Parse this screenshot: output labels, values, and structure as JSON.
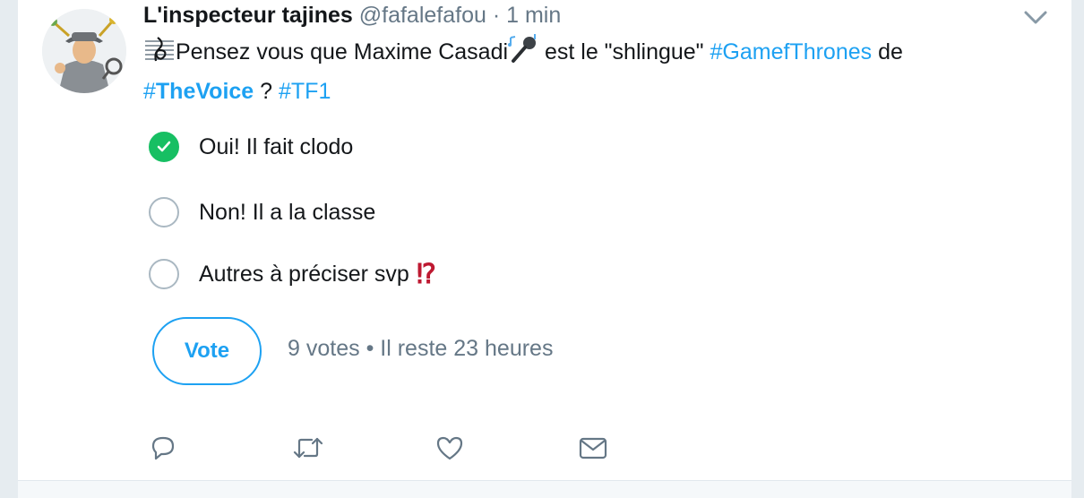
{
  "tweet": {
    "author_name": "L'inspecteur tajines",
    "handle": "@fafalefafou",
    "separator": "·",
    "time": "1 min",
    "text": {
      "part1": "Pensez vous que Maxime Casadi",
      "part2": " est le \"shlingue\" ",
      "hashtag1": "#GamefThrones",
      "part3": "  de",
      "hashtag2_hash": "#",
      "hashtag2_word": "TheVoice",
      "part4": " ? ",
      "hashtag3": "#TF1"
    }
  },
  "poll": {
    "options": [
      {
        "label": "Oui! Il fait clodo",
        "selected": true
      },
      {
        "label": "Non! Il a la classe",
        "selected": false
      },
      {
        "label": "Autres à préciser svp",
        "selected": false,
        "emoji": "⁉"
      }
    ],
    "vote_label": "Vote",
    "votes": "9 votes",
    "meta_separator": "•",
    "remaining": "Il reste 23 heures"
  },
  "actions": [
    "reply-icon",
    "retweet-icon",
    "like-icon",
    "direct-message-icon"
  ],
  "colors": {
    "accent": "#1da1f2",
    "selected": "#17bf63",
    "muted": "#657786",
    "emoji_red": "#be1931"
  }
}
